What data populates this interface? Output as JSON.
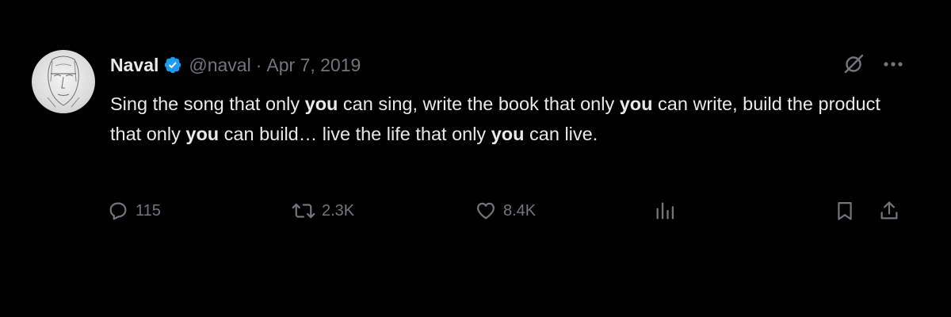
{
  "tweet": {
    "author": {
      "name": "Naval",
      "handle": "@naval",
      "verified": true,
      "avatar_icon": "sketch-face-avatar"
    },
    "separator": "·",
    "date": "Apr 7, 2019",
    "text_parts": [
      {
        "text": "Sing the song that only ",
        "bold": false
      },
      {
        "text": "you",
        "bold": true
      },
      {
        "text": " can sing, write the book that only ",
        "bold": false
      },
      {
        "text": "you",
        "bold": true
      },
      {
        "text": " can write, build the product that only ",
        "bold": false
      },
      {
        "text": "you",
        "bold": true
      },
      {
        "text": " can build… live the life that only ",
        "bold": false
      },
      {
        "text": "you",
        "bold": true
      },
      {
        "text": " can live.",
        "bold": false
      }
    ],
    "top_actions": {
      "grok_icon": "grok-icon",
      "more_icon": "more-icon"
    },
    "metrics": {
      "replies": "115",
      "reposts": "2.3K",
      "likes": "8.4K"
    }
  },
  "colors": {
    "background": "#000000",
    "primary_text": "#e7e9ea",
    "secondary_text": "#71767b",
    "verified_blue": "#1d9bf0"
  }
}
